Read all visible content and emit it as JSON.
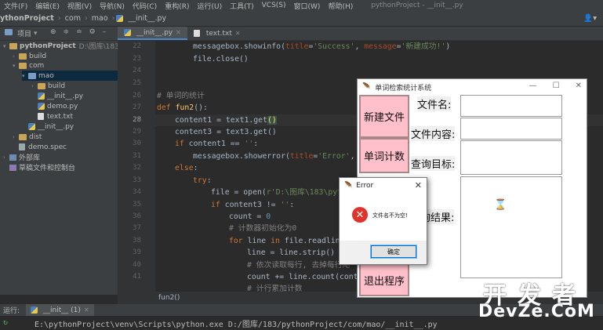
{
  "menu": {
    "items": [
      "文件(F)",
      "编辑(E)",
      "视图(V)",
      "导航(N)",
      "代码(C)",
      "重构(R)",
      "运行(U)",
      "工具(T)",
      "VCS(S)",
      "窗口(W)",
      "帮助(H)"
    ],
    "window_title": "pythonProject - __init__.py"
  },
  "nav": {
    "crumbs": [
      "ythonProject",
      "com",
      "mao",
      "__init__.py"
    ],
    "user_icon": "user-icon"
  },
  "project_panel": {
    "title": "项目",
    "tree": [
      {
        "label": "pythonProject",
        "path": "D:\\图库\\183\\pyth",
        "depth": 0,
        "type": "folder",
        "expanded": true
      },
      {
        "label": "build",
        "depth": 1,
        "type": "folder",
        "expanded": false
      },
      {
        "label": "com",
        "depth": 1,
        "type": "folder",
        "expanded": true
      },
      {
        "label": "mao",
        "depth": 2,
        "type": "folder",
        "expanded": true,
        "selected": true
      },
      {
        "label": "build",
        "depth": 3,
        "type": "folder",
        "expanded": false
      },
      {
        "label": "__init__.py",
        "depth": 3,
        "type": "py"
      },
      {
        "label": "demo.py",
        "depth": 3,
        "type": "py"
      },
      {
        "label": "text.txt",
        "depth": 3,
        "type": "txt"
      },
      {
        "label": "__init__.py",
        "depth": 2,
        "type": "py"
      },
      {
        "label": "dist",
        "depth": 1,
        "type": "folder",
        "expanded": false
      },
      {
        "label": "demo.spec",
        "depth": 1,
        "type": "spec"
      },
      {
        "label": "外部库",
        "depth": 0,
        "type": "lib",
        "expanded": false
      },
      {
        "label": "草稿文件和控制台",
        "depth": 0,
        "type": "scratch"
      }
    ]
  },
  "editor": {
    "tabs": [
      {
        "label": "__init__.py",
        "active": true
      },
      {
        "label": "text.txt",
        "active": false
      }
    ],
    "line_numbers": [
      "22",
      "23",
      "24",
      "25",
      "26",
      "27",
      "28",
      "29",
      "30",
      "31",
      "32",
      "33",
      "34",
      "35",
      "36",
      "37",
      "38",
      "39",
      "40",
      "41"
    ],
    "current_line": "28",
    "breadcrumb": "fun2()"
  },
  "run_panel": {
    "label": "运行:",
    "tab": "__init__ (1)",
    "command": "E:\\pythonProject\\venv\\Scripts\\python.exe D:/图库/183/pythonProject/com/mao/__init__.py"
  },
  "tk_window": {
    "title": "单词检索统计系统",
    "buttons": [
      "新建文件",
      "单词计数",
      "退出程序"
    ],
    "labels": [
      "文件名:",
      "文件内容:",
      "查询目标:",
      "询结果:"
    ]
  },
  "error_dialog": {
    "title": "Error",
    "message": "文件名不为空!",
    "ok_label": "确定",
    "icon_glyph": "✕"
  },
  "watermark": {
    "line1": "开发者",
    "line2": "DevZe.CoM"
  }
}
